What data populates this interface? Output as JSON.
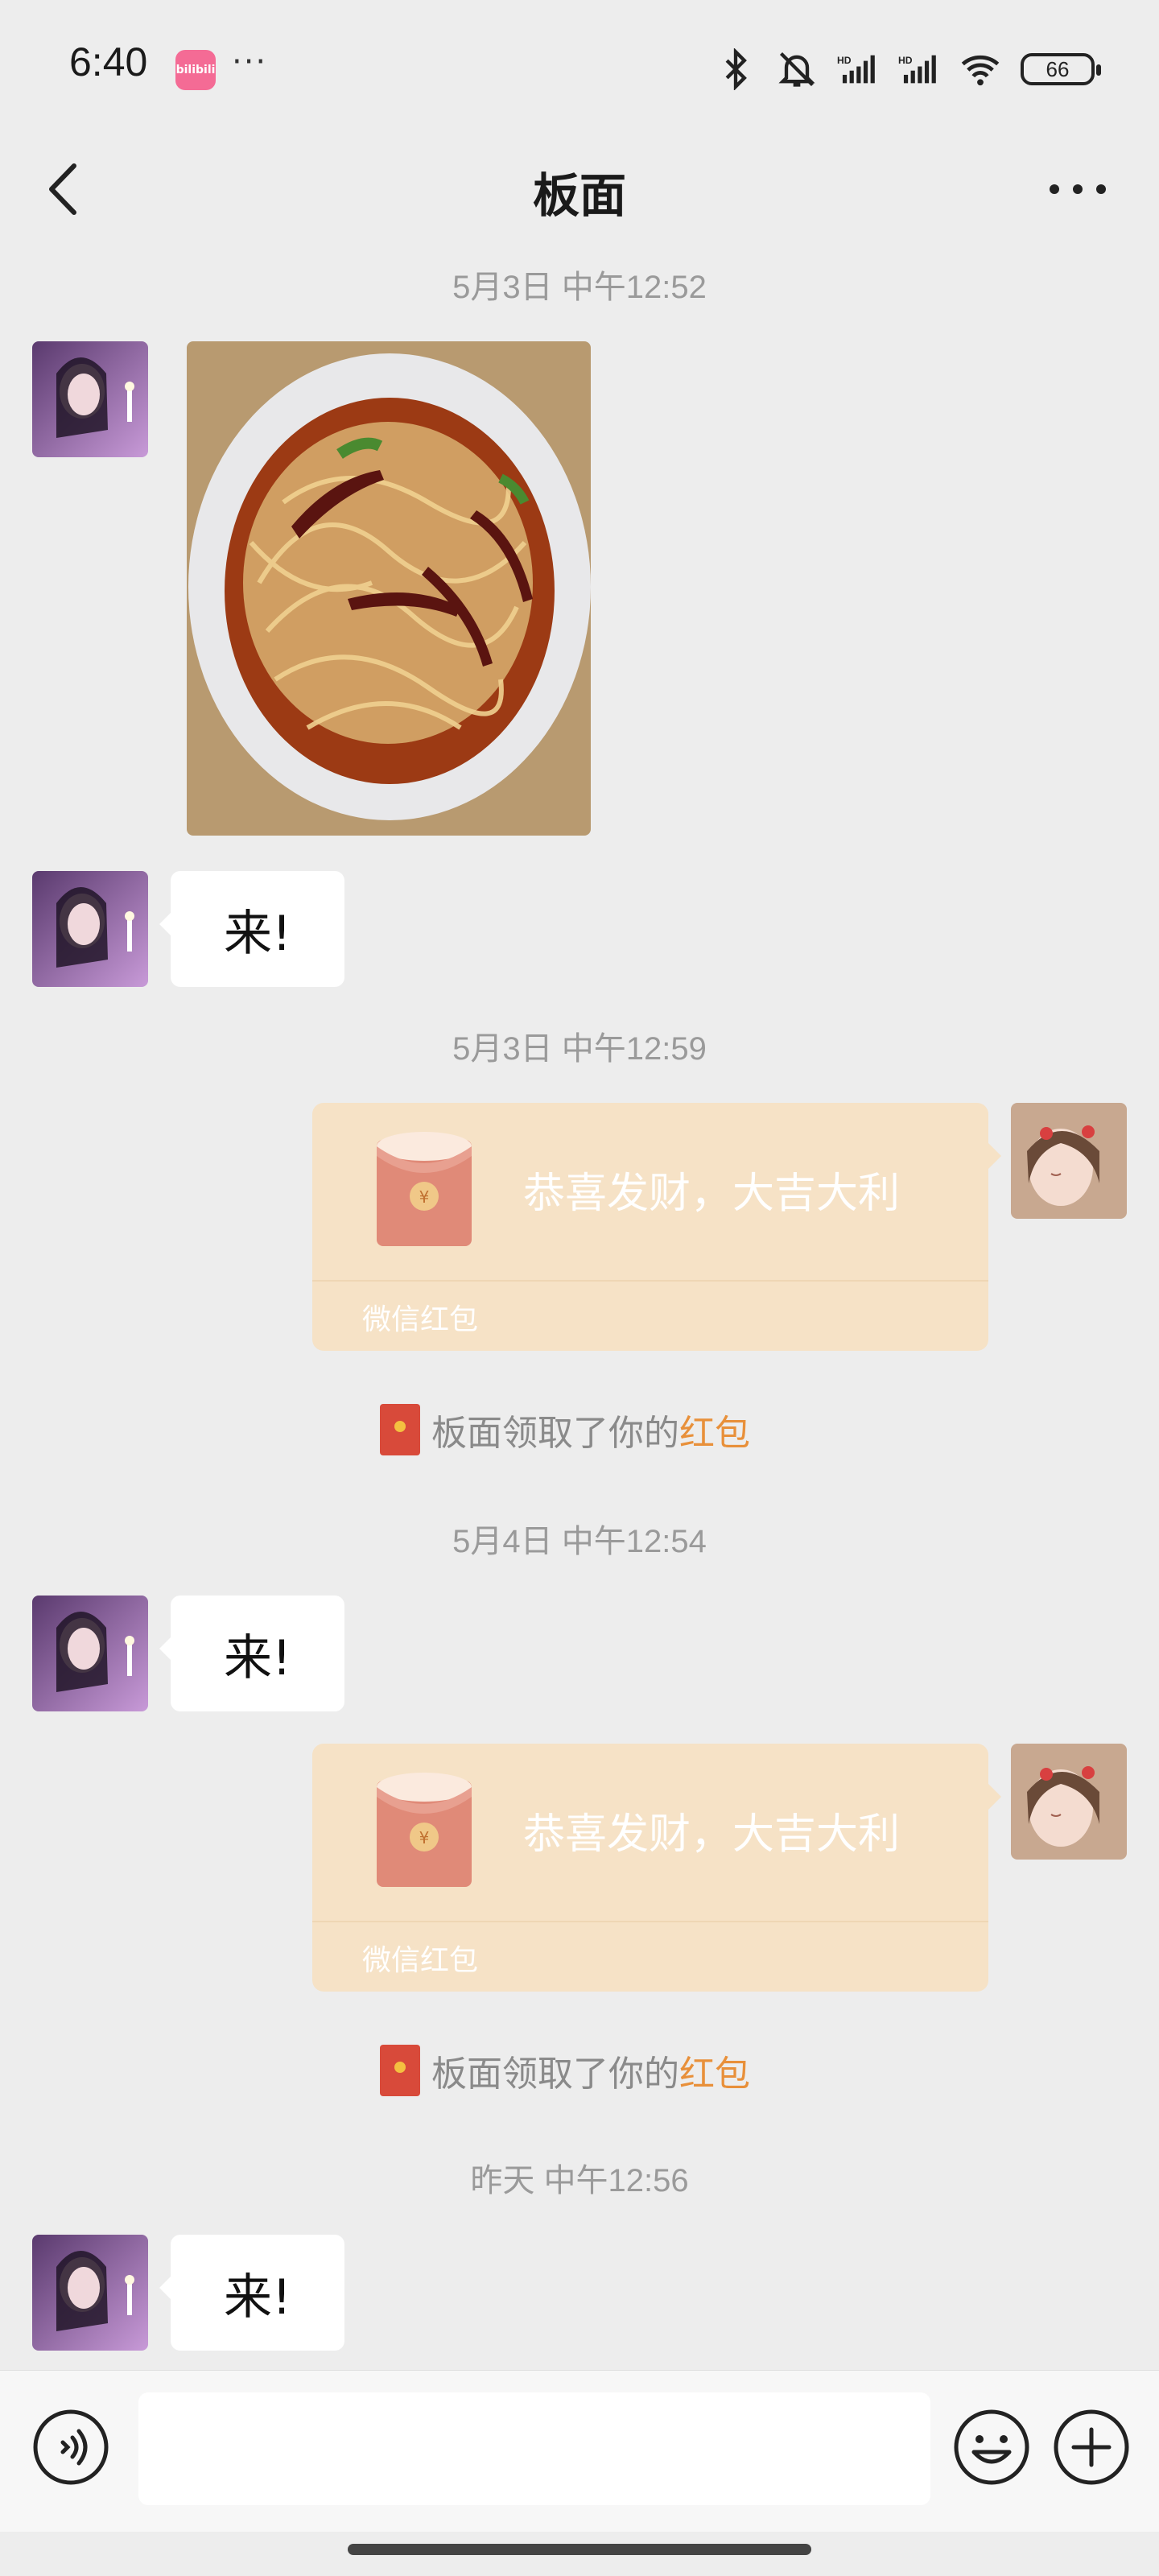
{
  "status_bar": {
    "time": "6:40",
    "app_badge": "bilibili",
    "more": "···",
    "battery": "66",
    "icons": [
      "bluetooth-icon",
      "mute-bell-icon",
      "signal-hd-icon",
      "signal-hd-icon",
      "wifi-icon",
      "battery-icon"
    ]
  },
  "header": {
    "title": "板面",
    "back_icon": "chevron-left-icon",
    "more_icon": "more-dots-icon"
  },
  "messages": [
    {
      "type": "timestamp",
      "text": "5月3日 中午12:52"
    },
    {
      "type": "image",
      "side": "left",
      "subject": "noodle-bowl"
    },
    {
      "type": "text",
      "side": "left",
      "text": "来!"
    },
    {
      "type": "timestamp",
      "text": "5月3日 中午12:59"
    },
    {
      "type": "red_packet",
      "side": "right",
      "text": "恭喜发财，大吉大利",
      "label": "微信红包"
    },
    {
      "type": "system",
      "text": "板面领取了你的",
      "link": "红包"
    },
    {
      "type": "timestamp",
      "text": "5月4日 中午12:54"
    },
    {
      "type": "text",
      "side": "left",
      "text": "来!"
    },
    {
      "type": "red_packet",
      "side": "right",
      "text": "恭喜发财，大吉大利",
      "label": "微信红包"
    },
    {
      "type": "system",
      "text": "板面领取了你的",
      "link": "红包"
    },
    {
      "type": "timestamp",
      "text": "昨天 中午12:56"
    },
    {
      "type": "text",
      "side": "left",
      "text": "来!"
    }
  ],
  "input_bar": {
    "placeholder": "",
    "icons": [
      "voice-icon",
      "emoji-icon",
      "plus-icon"
    ]
  },
  "colors": {
    "background": "#ededed",
    "red_packet": "#f6e2c6",
    "link": "#e8903a",
    "timestamp": "#9a9a9a"
  }
}
